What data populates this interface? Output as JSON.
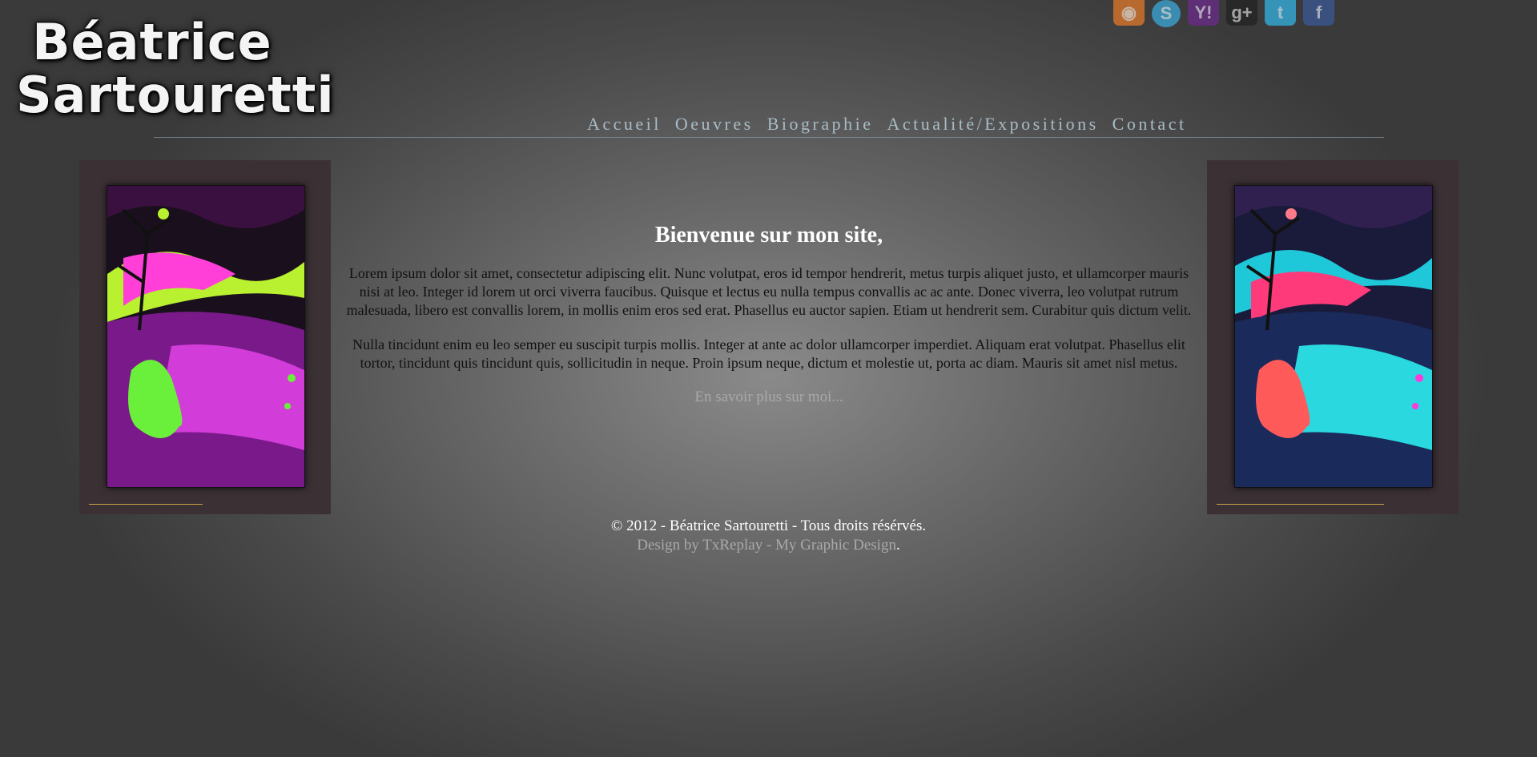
{
  "logo": {
    "line1": "Béatrice",
    "line2": "Sartouretti"
  },
  "social": [
    {
      "icon": "rss-icon",
      "glyph": "◉",
      "color": "#e2792a"
    },
    {
      "icon": "skype-icon",
      "glyph": "S",
      "color": "#3aa9d8"
    },
    {
      "icon": "yahoo-icon",
      "glyph": "Y!",
      "color": "#6b2a8a"
    },
    {
      "icon": "google-plus-icon",
      "glyph": "g+",
      "color": "#222222"
    },
    {
      "icon": "twitter-icon",
      "glyph": "t",
      "color": "#33b4e4"
    },
    {
      "icon": "facebook-icon",
      "glyph": "f",
      "color": "#3b5998"
    }
  ],
  "nav": {
    "accueil": "Accueil",
    "oeuvres": "Oeuvres",
    "biographie": "Biographie",
    "actualite": "Actualité/Expositions",
    "contact": "Contact"
  },
  "main": {
    "title": "Bienvenue sur mon site,",
    "para1": "Lorem ipsum dolor sit amet, consectetur adipiscing elit. Nunc volutpat, eros id tempor hendrerit, metus turpis aliquet justo, et ullamcorper mauris nisi at leo. Integer id lorem ut orci viverra faucibus. Quisque et lectus eu nulla tempus convallis ac ac ante. Donec viverra, leo volutpat rutrum malesuada, libero est convallis lorem, in mollis enim eros sed erat. Phasellus eu auctor sapien. Etiam ut hendrerit sem. Curabitur quis dictum velit.",
    "para2": "Nulla tincidunt enim eu leo semper eu suscipit turpis mollis. Integer at ante ac dolor ullamcorper imperdiet. Aliquam erat volutpat. Phasellus elit tortor, tincidunt quis tincidunt quis, sollicitudin in neque. Proin ipsum neque, dictum et molestie ut, porta ac diam. Mauris sit amet nisl metus.",
    "more": "En savoir plus sur moi..."
  },
  "footer": {
    "copyright": "© 2012 - Béatrice Sartouretti - Tous droits résérvés.",
    "design_by": "Design by ",
    "txreplay": "TxReplay",
    "sep": " - ",
    "mgd": "My Graphic Design",
    "dot": "."
  },
  "colors": {
    "accent_gold": "#c8a24a",
    "nav": "#a8bcc6",
    "panel": "#3b3134"
  }
}
